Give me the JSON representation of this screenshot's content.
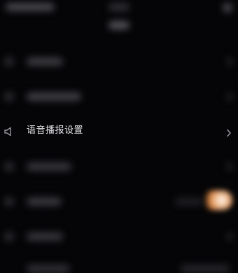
{
  "settings_list": {
    "focused_item": {
      "label": "语音播报设置",
      "icon": "speaker-icon",
      "trailing_icon": "chevron-right-icon"
    }
  },
  "colors": {
    "background": "#050507",
    "text_primary": "#e6e6ea",
    "icon": "#9a9aa0",
    "accent_glow": "#d9823f"
  }
}
